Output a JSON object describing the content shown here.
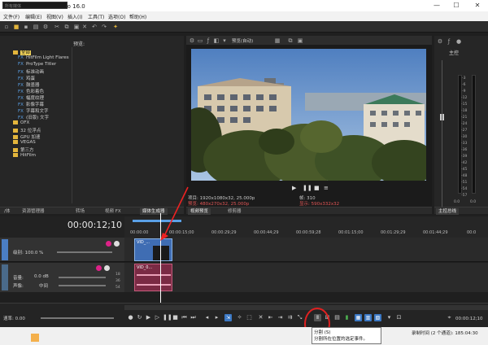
{
  "window": {
    "title": "无标题 * - VEGAS Pro 16.0",
    "controls": [
      "—",
      "☐",
      "✕"
    ]
  },
  "menu": [
    "文件(F)",
    "编辑(E)",
    "视图(V)",
    "插入(I)",
    "工具(T)",
    "选项(O)",
    "帮助(H)"
  ],
  "explorer": {
    "search_placeholder": "所有媒体",
    "preview_label": "预览:",
    "tree": [
      {
        "label": "全部",
        "type": "folder",
        "selected": true,
        "indent": 1
      },
      {
        "label": "HitFilm Light Flares",
        "type": "fx",
        "indent": 2
      },
      {
        "label": "ProType Titler",
        "type": "fx",
        "indent": 2
      },
      {
        "label": "标准动画",
        "type": "fx",
        "indent": 2
      },
      {
        "label": "鸡蛋",
        "type": "fx",
        "indent": 2
      },
      {
        "label": "鼓墨器",
        "type": "fx",
        "indent": 2
      },
      {
        "label": "色彩着色",
        "type": "fx",
        "indent": 2
      },
      {
        "label": "幅度纹理",
        "type": "fx",
        "indent": 2
      },
      {
        "label": "影像字幕",
        "type": "fx",
        "indent": 2
      },
      {
        "label": "字幕和文字",
        "type": "fx",
        "indent": 2
      },
      {
        "label": "(旧版) 文字",
        "type": "fx",
        "indent": 2
      },
      {
        "label": "OFX",
        "type": "folder",
        "indent": 1
      },
      {
        "label": "32 位浮点",
        "type": "folder",
        "indent": 1
      },
      {
        "label": "GPU 加速",
        "type": "folder",
        "indent": 1
      },
      {
        "label": "VEGAS",
        "type": "folder",
        "indent": 1
      },
      {
        "label": "第三方",
        "type": "folder",
        "indent": 1
      },
      {
        "label": "HitFilm",
        "type": "folder",
        "indent": 1
      }
    ],
    "tabs": [
      "/体",
      "资源管理器",
      "转场",
      "视频 FX",
      "媒体生成器"
    ]
  },
  "preview": {
    "toolbar_label": "预览(自动)",
    "project": "项目: 1920x1080x32, 25.000p",
    "preview_res": "预览: 480x270x32, 25.000p",
    "frame": "帧: 310",
    "display": "显示: 590x332x32",
    "tabs": [
      "视频预览",
      "修剪器"
    ]
  },
  "master": {
    "label": "主控",
    "bus_tab": "主控总线",
    "levels": [
      "-3",
      "-6",
      "-9",
      "-12",
      "-15",
      "-18",
      "-21",
      "-24",
      "-27",
      "-30",
      "-33",
      "-36",
      "-39",
      "-42",
      "-45",
      "-48",
      "-51",
      "-54",
      "-57"
    ],
    "bottom": [
      "0.0",
      "0.0"
    ]
  },
  "timeline": {
    "timecode": "00:00:12;10",
    "ruler": [
      "00:00:00",
      "00:00:15;00",
      "00:00:29;29",
      "00:00:44;29",
      "00:00:59;28",
      "00:01:15;00",
      "00:01:29;29",
      "00:01:44;29",
      "00:0"
    ],
    "video_track": {
      "level_label": "级别: 100.0 %",
      "clip": "VID_..."
    },
    "audio_track": {
      "volume_label": "音量:",
      "volume": "0.0 dB",
      "pan_label": "声像:",
      "pan": "中间",
      "clip": "VID_0...",
      "meter_scale": [
        "18",
        "36",
        "54"
      ]
    },
    "rate_label": "速率: 0.00",
    "end_time": "00:00:12;10"
  },
  "tooltip": {
    "title": "分割 (S)",
    "body": "分割所在位置的选定事件。"
  },
  "status": {
    "text": "录制时间 (2 个通道): 185:04:30"
  }
}
